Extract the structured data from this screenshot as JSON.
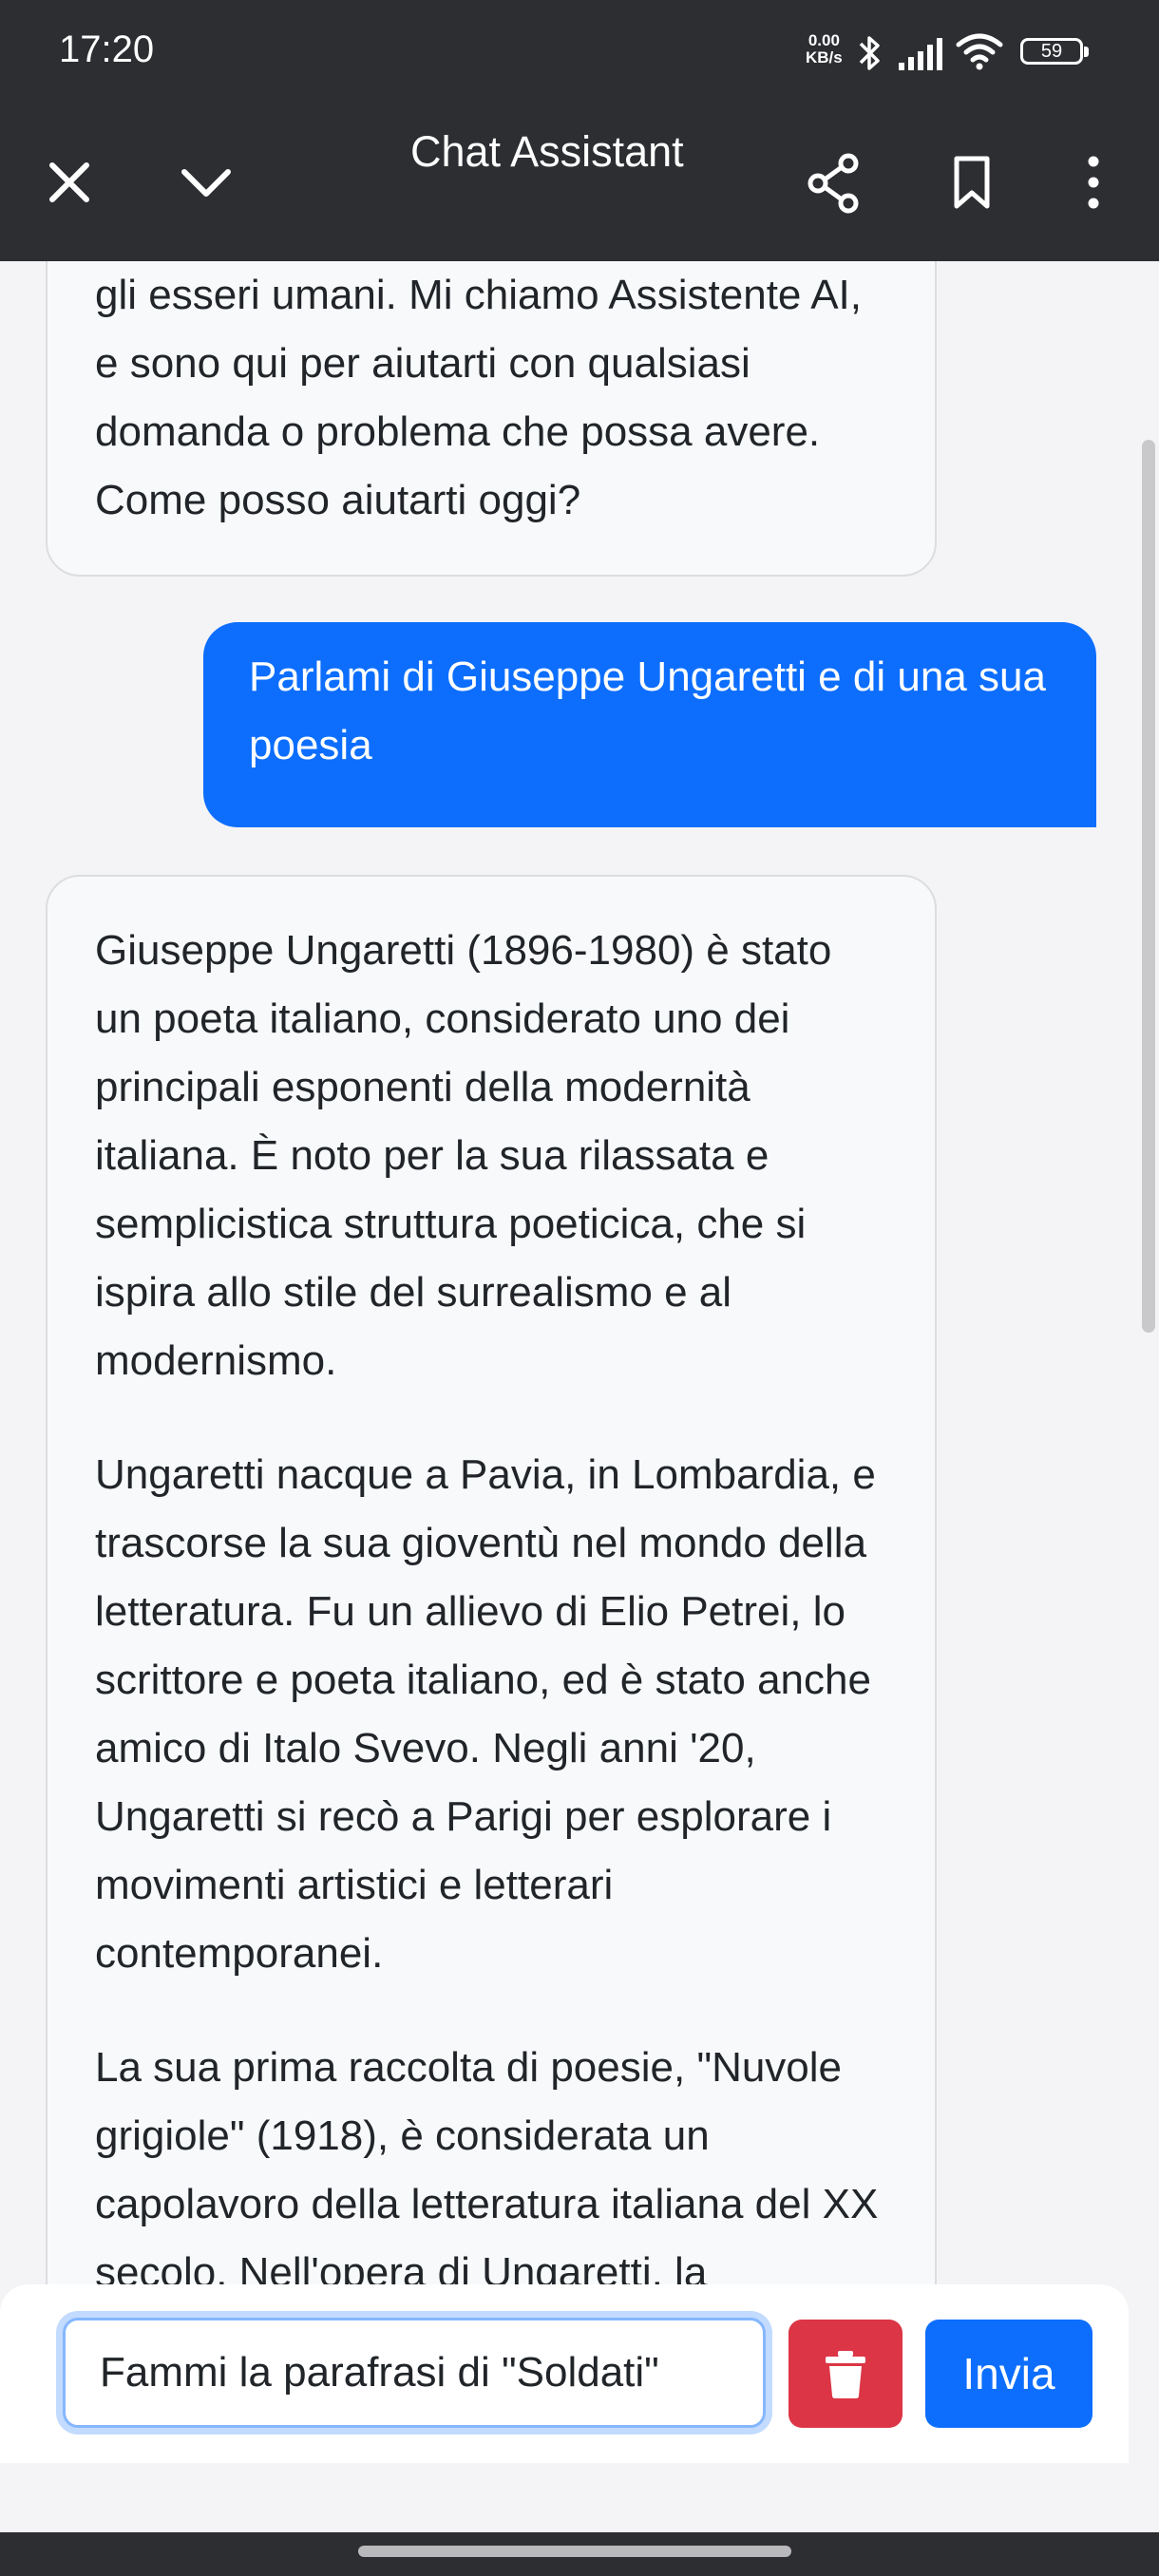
{
  "status_bar": {
    "time": "17:20",
    "net_speed_value": "0.00",
    "net_speed_unit": "KB/s",
    "battery": "59",
    "icons": [
      "bluetooth-icon",
      "signal-icon",
      "wifi-icon",
      "battery-icon"
    ]
  },
  "toolbar": {
    "title": "Chat Assistant",
    "icons": [
      "close-icon",
      "chevron-down-icon",
      "share-icon",
      "bookmark-icon",
      "more-vertical-icon"
    ]
  },
  "chat": {
    "messages": [
      {
        "role": "assistant",
        "paragraphs": [
          "gli esseri umani. Mi chiamo Assistente AI, e sono qui per aiutarti con qualsiasi domanda o problema che possa avere. Come posso aiutarti oggi?"
        ]
      },
      {
        "role": "user",
        "text": "Parlami di Giuseppe Ungaretti e di una sua poesia"
      },
      {
        "role": "assistant",
        "paragraphs": [
          "Giuseppe Ungaretti (1896-1980) è stato un poeta italiano, considerato uno dei principali esponenti della modernità italiana. È noto per la sua rilassata e semplicistica struttura poeticica, che si ispira allo stile del surrealismo e al modernismo.",
          "Ungaretti nacque a Pavia, in Lombardia, e trascorse la sua gioventù nel mondo della letteratura. Fu un allievo di Elio Petrei, lo scrittore e poeta italiano, ed è stato anche amico di Italo Svevo. Negli anni '20, Ungaretti si recò a Parigi per esplorare i movimenti artistici e letterari contemporanei.",
          "La sua prima raccolta di poesie, \"Nuvole grigiole\" (1918), è considerata un capolavoro della letteratura italiana del XX secolo. Nell'opera di Ungaretti, la"
        ]
      }
    ]
  },
  "input": {
    "value": "Fammi la parafrasi di \"Soldati\"",
    "send_label": "Invia",
    "delete_icon": "trash-icon"
  },
  "colors": {
    "bar_bg": "#2d2e32",
    "user_bubble": "#0d6efd",
    "delete_button": "#dc3545",
    "send_button": "#0d6efd"
  }
}
